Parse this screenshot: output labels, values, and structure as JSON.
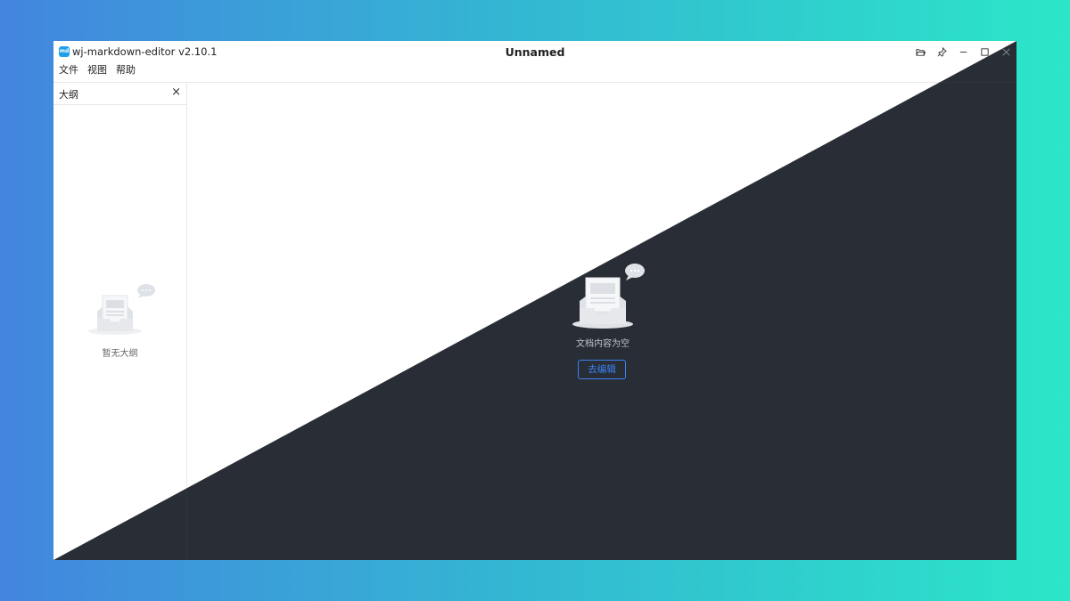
{
  "app": {
    "logo_text": "md",
    "name": "wj-markdown-editor v2.10.1",
    "document_title": "Unnamed"
  },
  "window_controls": [
    {
      "icon": "folder-open-icon"
    },
    {
      "icon": "pin-icon"
    },
    {
      "icon": "minimize-icon"
    },
    {
      "icon": "maximize-icon"
    },
    {
      "icon": "close-icon"
    }
  ],
  "menu": {
    "file": "文件",
    "view": "视图",
    "help": "帮助"
  },
  "outline": {
    "title": "大纲",
    "close": "×",
    "empty_text": "暂无大纲"
  },
  "editor": {
    "empty_text": "文档内容为空",
    "go_edit_label": "去编辑"
  },
  "theme": {
    "light_bg": "#ffffff",
    "dark_bg": "#292d35",
    "accent": "#2d6be4"
  }
}
